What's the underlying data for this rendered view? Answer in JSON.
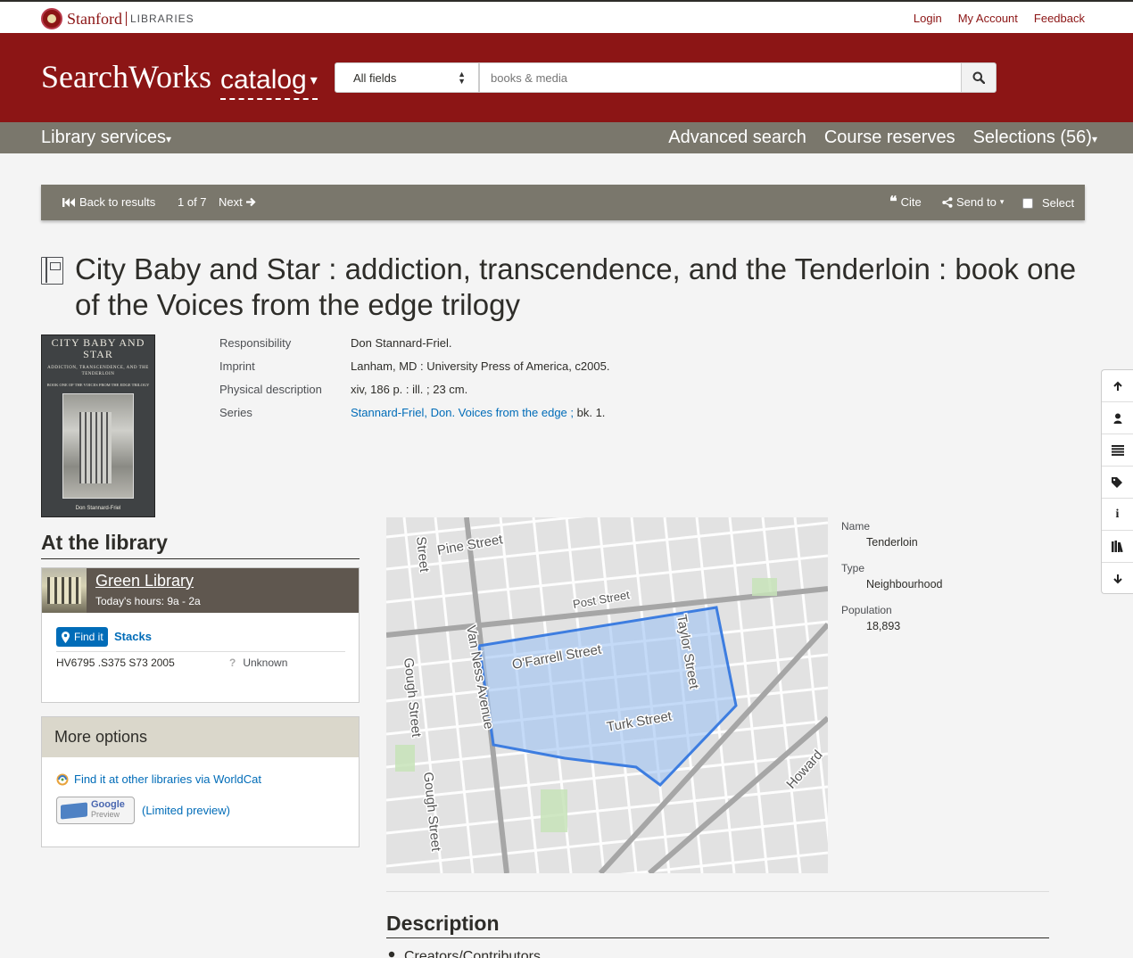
{
  "topbar": {
    "brand": "Stanford",
    "brand_sub": "LIBRARIES",
    "links": [
      "Login",
      "My Account",
      "Feedback"
    ]
  },
  "masthead": {
    "logo": "SearchWorks",
    "catalog": "catalog",
    "search_field": "All fields",
    "search_placeholder": "books & media"
  },
  "nav": {
    "library_services": "Library services",
    "advanced_search": "Advanced search",
    "course_reserves": "Course reserves",
    "selections": "Selections (56)"
  },
  "toolbar": {
    "back": "Back to results",
    "position": "1 of 7",
    "next": "Next",
    "cite": "Cite",
    "send_to": "Send to",
    "select": "Select"
  },
  "record": {
    "title": "City Baby and Star : addiction, transcendence, and the Tenderloin : book one of the Voices from the edge trilogy",
    "cover": {
      "title": "CITY BABY AND STAR",
      "subtitle": "ADDICTION, TRANSCENDENCE, AND THE TENDERLOIN",
      "series": "BOOK ONE OF THE VOICES FROM THE EDGE TRILOGY",
      "author": "Don Stannard-Friel"
    },
    "fields": [
      {
        "label": "Responsibility",
        "value": "Don Stannard-Friel."
      },
      {
        "label": "Imprint",
        "value": "Lanham, MD : University Press of America, c2005."
      },
      {
        "label": "Physical description",
        "value": "xiv, 186 p. : ill. ; 23 cm."
      }
    ],
    "series": {
      "label": "Series",
      "link": "Stannard-Friel, Don. Voices from the edge ;",
      "rest": " bk. 1."
    }
  },
  "library": {
    "heading": "At the library",
    "name": "Green Library",
    "hours": "Today's hours: 9a - 2a",
    "find_it": "Find it",
    "location": "Stacks",
    "call_number": "HV6795 .S375 S73 2005",
    "status": "Unknown"
  },
  "more_options": {
    "heading": "More options",
    "worldcat": "Find it at other libraries via WorldCat",
    "google_logo": "Google",
    "google_preview_word": "Preview",
    "google_preview": "(Limited preview)"
  },
  "map": {
    "street_labels": [
      "Pine Street",
      "Post Street",
      "O'Farrell Street",
      "Turk Street",
      "Taylor Street",
      "Van Ness Avenue",
      "Gough Street",
      "Gough Street",
      "Howard",
      "Street"
    ],
    "highlight_color": "#3d7de0"
  },
  "place": {
    "fields": [
      {
        "label": "Name",
        "value": "Tenderloin"
      },
      {
        "label": "Type",
        "value": "Neighbourhood"
      },
      {
        "label": "Population",
        "value": "18,893"
      }
    ]
  },
  "sidenav": [
    "arrow-up-icon",
    "user-icon",
    "list-icon",
    "tags-icon",
    "info-icon",
    "books-icon",
    "arrow-down-icon"
  ],
  "description": {
    "heading": "Description",
    "sub": "Creators/Contributors"
  },
  "colors": {
    "brand_red": "#8c1515",
    "nav_gray": "#7a776c",
    "link_blue": "#006cb8"
  }
}
